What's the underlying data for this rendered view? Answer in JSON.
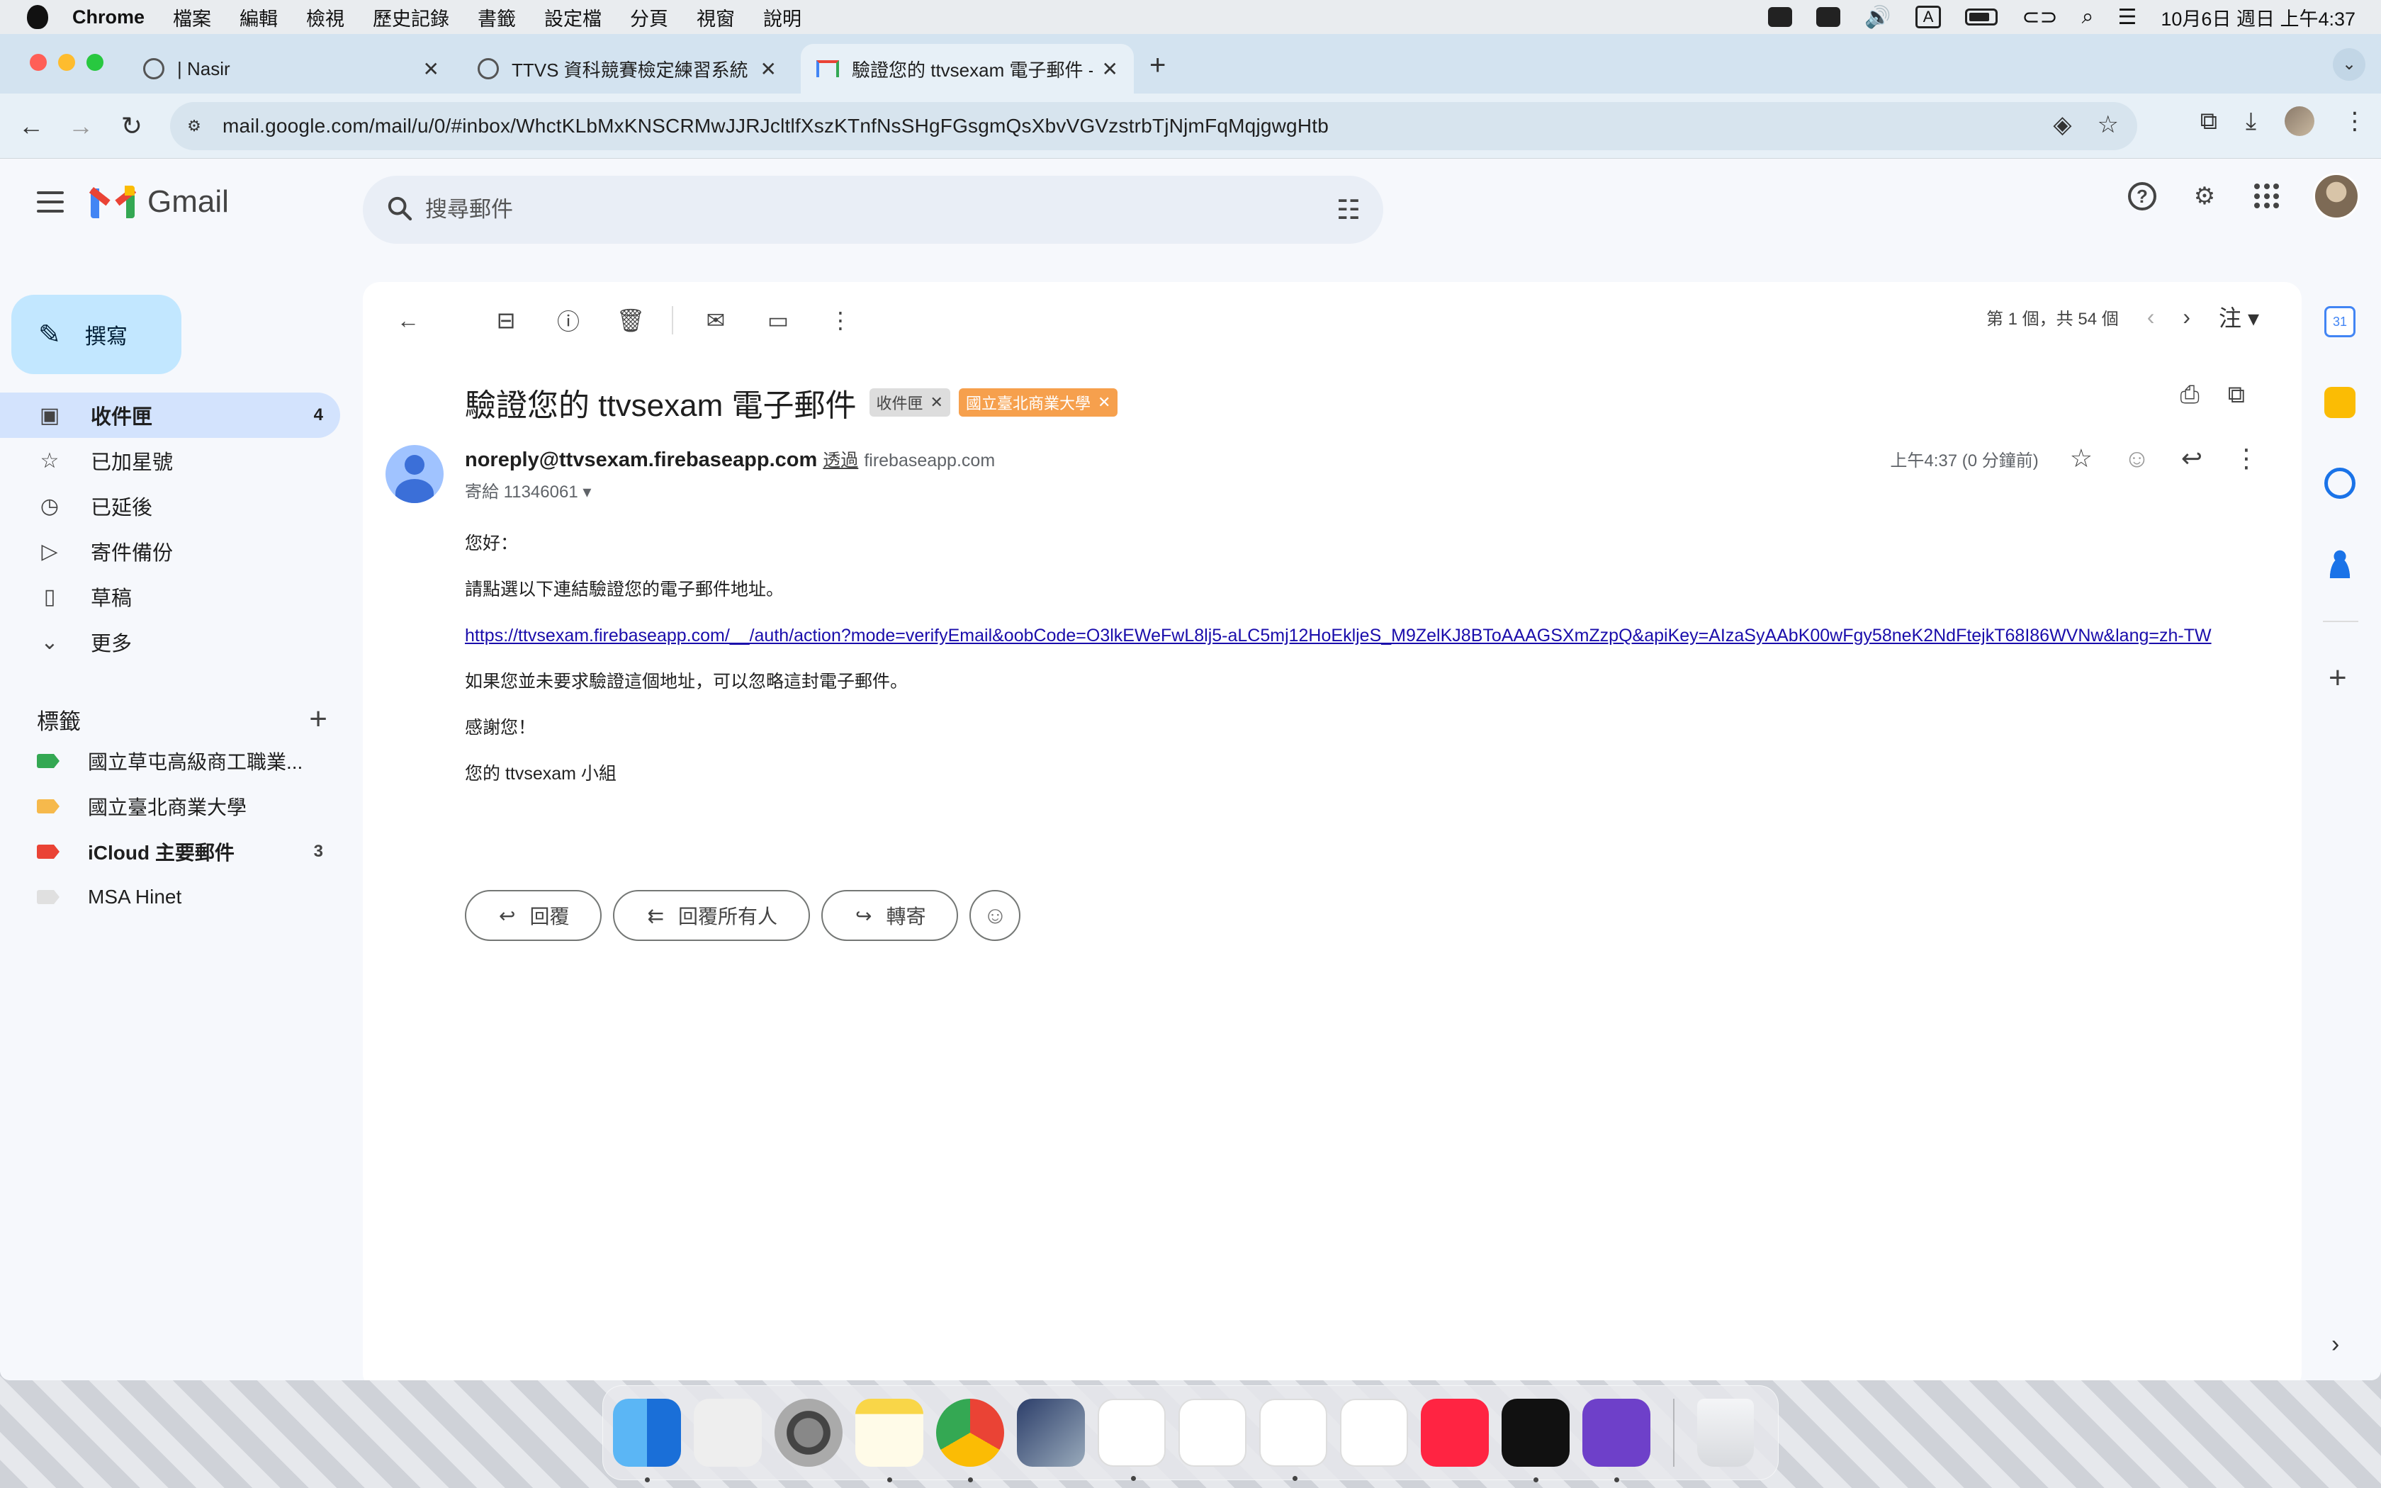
{
  "menubar": {
    "app": "Chrome",
    "items": [
      "檔案",
      "編輯",
      "檢視",
      "歷史記錄",
      "書籤",
      "設定檔",
      "分頁",
      "視窗",
      "說明"
    ],
    "datetime": "10月6日 週日 上午4:37",
    "input_indicator": "A"
  },
  "tabs": [
    {
      "title": "| Nasir"
    },
    {
      "title": "TTVS 資科競賽檢定練習系統"
    },
    {
      "title": "驗證您的 ttvsexam 電子郵件 - ("
    }
  ],
  "omnibox": {
    "url": "mail.google.com/mail/u/0/#inbox/WhctKLbMxKNSCRMwJJRJcltlfXszKTnfNsSHgFGsgmQsXbvVGVzstrbTjNjmFqMqjgwgHtb"
  },
  "gmail": {
    "logo_text": "Gmail",
    "search_placeholder": "搜尋郵件",
    "compose_label": "撰寫",
    "nav": [
      {
        "label": "收件匣",
        "count": "4",
        "icon": "inbox-icon"
      },
      {
        "label": "已加星號",
        "count": "",
        "icon": "star-icon"
      },
      {
        "label": "已延後",
        "count": "",
        "icon": "clock-icon"
      },
      {
        "label": "寄件備份",
        "count": "",
        "icon": "send-icon"
      },
      {
        "label": "草稿",
        "count": "",
        "icon": "draft-icon"
      },
      {
        "label": "更多",
        "count": "",
        "icon": "chevron-down-icon"
      }
    ],
    "labels_heading": "標籤",
    "labels": [
      {
        "label": "國立草屯高級商工職業...",
        "count": "",
        "color": "#34a853"
      },
      {
        "label": "國立臺北商業大學",
        "count": "",
        "color": "#f6b94c"
      },
      {
        "label": "iCloud 主要郵件",
        "count": "3",
        "color": "#ea4335"
      },
      {
        "label": "MSA Hinet",
        "count": "",
        "color": "#e0e0e0"
      }
    ],
    "pager": {
      "text": "第 1 個，共 54 個",
      "lang": "注"
    },
    "message": {
      "subject": "驗證您的 ttvsexam 電子郵件",
      "chip_inbox": "收件匣",
      "chip_label": "國立臺北商業大學",
      "sender": "noreply@ttvsexam.firebaseapp.com",
      "via": "透過",
      "via_domain": "firebaseapp.com",
      "to": "寄給 11346061",
      "time": "上午4:37 (0 分鐘前)",
      "body": {
        "greeting": "您好：",
        "line1": "請點選以下連結驗證您的電子郵件地址。",
        "link": "https://ttvsexam.firebaseapp.com/__/auth/action?mode=verifyEmail&oobCode=O3lkEWeFwL8lj5-aLC5mj12HoEkljeS_M9ZelKJ8BToAAAGSXmZzpQ&apiKey=AIzaSyAAbK00wFgy58neK2NdFtejkT68I86WVNw&lang=zh-TW",
        "line2": "如果您並未要求驗證這個地址，可以忽略這封電子郵件。",
        "thanks": "感謝您！",
        "signoff": "您的 ttvsexam 小組"
      }
    },
    "reply_buttons": {
      "reply": "回覆",
      "reply_all": "回覆所有人",
      "forward": "轉寄"
    }
  },
  "colors": {
    "accent": "#0b57d0",
    "compose_bg": "#c2e7ff",
    "active_nav": "#d3e3fd",
    "chip_orange": "#f6a04d"
  }
}
